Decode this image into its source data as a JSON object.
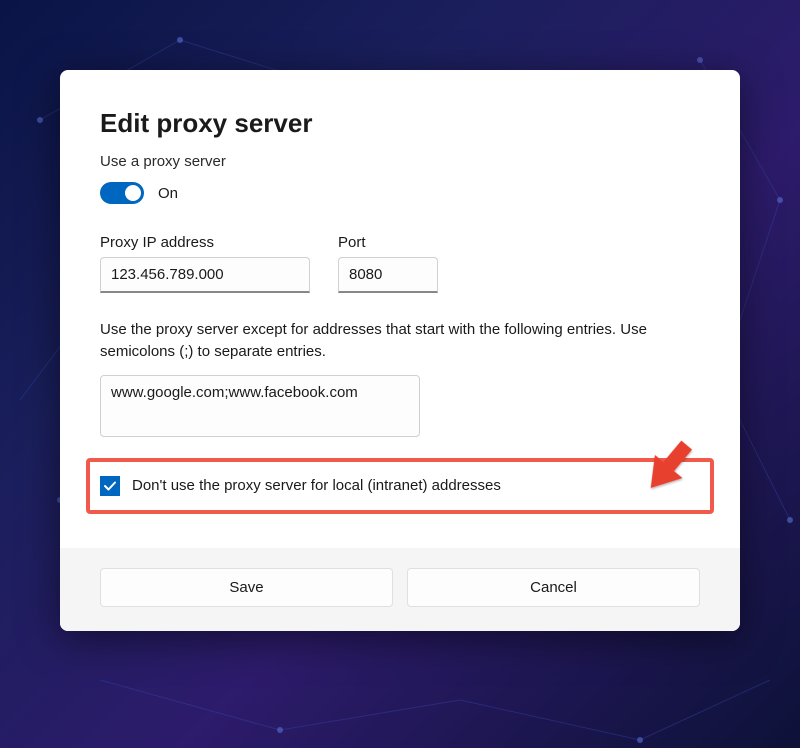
{
  "dialog": {
    "title": "Edit proxy server",
    "subtitle": "Use a proxy server",
    "toggle": {
      "state_label": "On",
      "on": true
    },
    "ip": {
      "label": "Proxy IP address",
      "value": "123.456.789.000"
    },
    "port": {
      "label": "Port",
      "value": "8080"
    },
    "exceptions": {
      "description": "Use the proxy server except for addresses that start with the following entries. Use semicolons (;) to separate entries.",
      "value": "www.google.com;www.facebook.com"
    },
    "local_bypass": {
      "label": "Don't use the proxy server for local (intranet) addresses",
      "checked": true
    },
    "buttons": {
      "save": "Save",
      "cancel": "Cancel"
    }
  },
  "colors": {
    "accent": "#0067c0",
    "highlight": "#f15a4a"
  }
}
